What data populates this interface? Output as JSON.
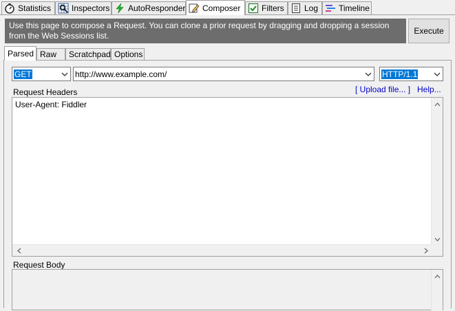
{
  "tabs": [
    {
      "label": "Statistics",
      "icon": "stopwatch-icon",
      "active": false
    },
    {
      "label": "Inspectors",
      "icon": "magnifier-grid-icon",
      "active": false
    },
    {
      "label": "AutoResponder",
      "icon": "lightning-icon",
      "active": false
    },
    {
      "label": "Composer",
      "icon": "pencil-edit-icon",
      "active": true
    },
    {
      "label": "Filters",
      "icon": "checkbox-icon",
      "active": false
    },
    {
      "label": "Log",
      "icon": "document-icon",
      "active": false
    },
    {
      "label": "Timeline",
      "icon": "timeline-bars-icon",
      "active": false
    }
  ],
  "banner": {
    "text": "Use this page to compose a Request. You can clone a prior request by dragging and dropping a session from the Web Sessions list."
  },
  "execute_label": "Execute",
  "subtabs": [
    {
      "label": "Parsed",
      "active": true
    },
    {
      "label": "Raw",
      "active": false
    },
    {
      "label": "Scratchpad",
      "active": false
    },
    {
      "label": "Options",
      "active": false
    }
  ],
  "request": {
    "method": "GET",
    "url": "http://www.example.com/",
    "version": "HTTP/1.1"
  },
  "headers": {
    "label": "Request Headers",
    "upload_link": "[ Upload file... ]",
    "help_link": "Help...",
    "text": "User-Agent: Fiddler"
  },
  "body": {
    "label": "Request Body",
    "text": ""
  },
  "colors": {
    "banner_bg": "#6d6d6d",
    "selection": "#0078d7",
    "link": "#0000cc"
  }
}
